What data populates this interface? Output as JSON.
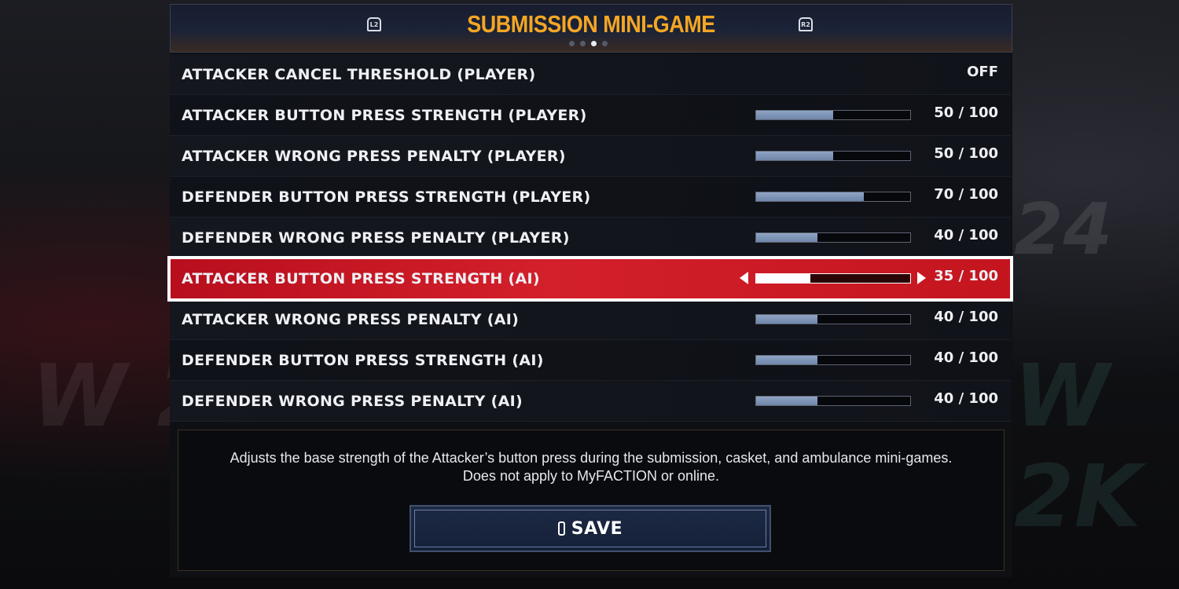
{
  "header": {
    "title": "SUBMISSION MINI-GAME",
    "left_button": "L2",
    "right_button": "R2",
    "page_dots": 4,
    "active_page": 3
  },
  "settings": [
    {
      "label": "ATTACKER CANCEL THRESHOLD (PLAYER)",
      "value": "OFF"
    },
    {
      "label": "ATTACKER BUTTON PRESS STRENGTH (PLAYER)",
      "value": "50 / 100",
      "fraction": 0.5
    },
    {
      "label": "ATTACKER WRONG PRESS PENALTY (PLAYER)",
      "value": "50 / 100",
      "fraction": 0.5
    },
    {
      "label": "DEFENDER BUTTON PRESS STRENGTH (PLAYER)",
      "value": "70 / 100",
      "fraction": 0.7
    },
    {
      "label": "DEFENDER WRONG PRESS PENALTY (PLAYER)",
      "value": "40 / 100",
      "fraction": 0.4
    },
    {
      "label": "ATTACKER BUTTON PRESS STRENGTH (AI)",
      "value": "35 / 100",
      "fraction": 0.35,
      "selected": true
    },
    {
      "label": "ATTACKER WRONG PRESS PENALTY (AI)",
      "value": "40 / 100",
      "fraction": 0.4
    },
    {
      "label": "DEFENDER BUTTON PRESS STRENGTH (AI)",
      "value": "40 / 100",
      "fraction": 0.4
    },
    {
      "label": "DEFENDER WRONG PRESS PENALTY (AI)",
      "value": "40 / 100",
      "fraction": 0.4
    }
  ],
  "description": {
    "line1": "Adjusts the base strength of the Attacker’s button press during the submission, casket, and ambulance mini-games.",
    "line2": "Does not apply to MyFACTION or online."
  },
  "save_button": {
    "label": "SAVE",
    "icon": "controller-button-icon"
  },
  "colors": {
    "title": "#f5a623",
    "selected_row": "#d3202b",
    "bar_fill": "#8fa4c4"
  }
}
